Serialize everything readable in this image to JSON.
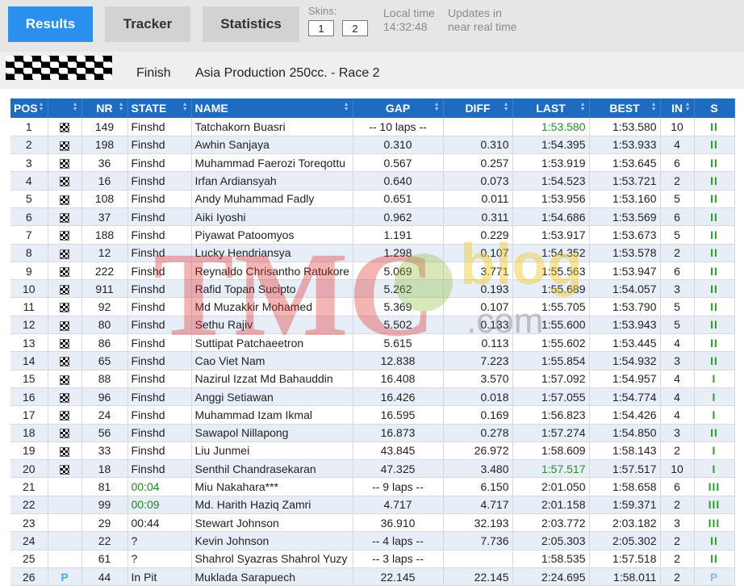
{
  "nav": {
    "results_label": "Results",
    "tracker_label": "Tracker",
    "statistics_label": "Statistics",
    "skins_label": "Skins:",
    "skin1_label": "1",
    "skin2_label": "2",
    "local_time_label": "Local time",
    "local_time_value": "14:32:48",
    "updates_line1": "Updates in",
    "updates_line2": "near real time"
  },
  "race": {
    "status": "Finish",
    "name": "Asia Production 250cc. - Race 2"
  },
  "watermark": {
    "text_left": "TMC",
    "text_right": "blog",
    "text_domain": ".com"
  },
  "columns": [
    "POS",
    "NR",
    "STATE",
    "NAME",
    "GAP",
    "DIFF",
    "LAST",
    "BEST",
    "IN",
    "S"
  ],
  "colors": {
    "header_bg": "#1d6cc1",
    "accent": "#2b8fee",
    "green": "#2aa02a",
    "pit": "#4aa8e6"
  },
  "rows": [
    {
      "pos": "1",
      "flag": "checkered",
      "nr": "149",
      "state": "Finshd",
      "name": "Tatchakorn Buasri",
      "gap": "-- 10 laps --",
      "diff": "",
      "last": "1:53.580",
      "last_best": true,
      "best": "1:53.580",
      "in": "10",
      "s": "II",
      "s_color": "g"
    },
    {
      "pos": "2",
      "flag": "checkered",
      "nr": "198",
      "state": "Finshd",
      "name": "Awhin Sanjaya",
      "gap": "0.310",
      "diff": "0.310",
      "last": "1:54.395",
      "last_best": false,
      "best": "1:53.933",
      "in": "4",
      "s": "II",
      "s_color": "g"
    },
    {
      "pos": "3",
      "flag": "checkered",
      "nr": "36",
      "state": "Finshd",
      "name": "Muhammad Faerozi Toreqottu",
      "gap": "0.567",
      "diff": "0.257",
      "last": "1:53.919",
      "last_best": false,
      "best": "1:53.645",
      "in": "6",
      "s": "II",
      "s_color": "g"
    },
    {
      "pos": "4",
      "flag": "checkered",
      "nr": "16",
      "state": "Finshd",
      "name": "Irfan Ardiansyah",
      "gap": "0.640",
      "diff": "0.073",
      "last": "1:54.523",
      "last_best": false,
      "best": "1:53.721",
      "in": "2",
      "s": "II",
      "s_color": "g"
    },
    {
      "pos": "5",
      "flag": "checkered",
      "nr": "108",
      "state": "Finshd",
      "name": "Andy Muhammad Fadly",
      "gap": "0.651",
      "diff": "0.011",
      "last": "1:53.956",
      "last_best": false,
      "best": "1:53.160",
      "in": "5",
      "s": "II",
      "s_color": "g"
    },
    {
      "pos": "6",
      "flag": "checkered",
      "nr": "37",
      "state": "Finshd",
      "name": "Aiki Iyoshi",
      "gap": "0.962",
      "diff": "0.311",
      "last": "1:54.686",
      "last_best": false,
      "best": "1:53.569",
      "in": "6",
      "s": "II",
      "s_color": "g"
    },
    {
      "pos": "7",
      "flag": "checkered",
      "nr": "188",
      "state": "Finshd",
      "name": "Piyawat Patoomyos",
      "gap": "1.191",
      "diff": "0.229",
      "last": "1:53.917",
      "last_best": false,
      "best": "1:53.673",
      "in": "5",
      "s": "II",
      "s_color": "g"
    },
    {
      "pos": "8",
      "flag": "checkered",
      "nr": "12",
      "state": "Finshd",
      "name": "Lucky Hendriansya",
      "gap": "1.298",
      "diff": "0.107",
      "last": "1:54.352",
      "last_best": false,
      "best": "1:53.578",
      "in": "2",
      "s": "II",
      "s_color": "g"
    },
    {
      "pos": "9",
      "flag": "checkered",
      "nr": "222",
      "state": "Finshd",
      "name": "Reynaldo Chrisantho Ratukore",
      "gap": "5.069",
      "diff": "3.771",
      "last": "1:55.563",
      "last_best": false,
      "best": "1:53.947",
      "in": "6",
      "s": "II",
      "s_color": "g"
    },
    {
      "pos": "10",
      "flag": "checkered",
      "nr": "911",
      "state": "Finshd",
      "name": "Rafid Topan Sucipto",
      "gap": "5.262",
      "diff": "0.193",
      "last": "1:55.689",
      "last_best": false,
      "best": "1:54.057",
      "in": "3",
      "s": "II",
      "s_color": "g"
    },
    {
      "pos": "11",
      "flag": "checkered",
      "nr": "92",
      "state": "Finshd",
      "name": "Md Muzakkir Mohamed",
      "gap": "5.369",
      "diff": "0.107",
      "last": "1:55.705",
      "last_best": false,
      "best": "1:53.790",
      "in": "5",
      "s": "II",
      "s_color": "g"
    },
    {
      "pos": "12",
      "flag": "checkered",
      "nr": "80",
      "state": "Finshd",
      "name": "Sethu Rajiv",
      "gap": "5.502",
      "diff": "0.133",
      "last": "1:55.600",
      "last_best": false,
      "best": "1:53.943",
      "in": "5",
      "s": "II",
      "s_color": "g"
    },
    {
      "pos": "13",
      "flag": "checkered",
      "nr": "86",
      "state": "Finshd",
      "name": "Suttipat Patchaeetron",
      "gap": "5.615",
      "diff": "0.113",
      "last": "1:55.602",
      "last_best": false,
      "best": "1:53.445",
      "in": "4",
      "s": "II",
      "s_color": "g"
    },
    {
      "pos": "14",
      "flag": "checkered",
      "nr": "65",
      "state": "Finshd",
      "name": "Cao Viet Nam",
      "gap": "12.838",
      "diff": "7.223",
      "last": "1:55.854",
      "last_best": false,
      "best": "1:54.932",
      "in": "3",
      "s": "II",
      "s_color": "g"
    },
    {
      "pos": "15",
      "flag": "checkered",
      "nr": "88",
      "state": "Finshd",
      "name": "Nazirul Izzat Md Bahauddin",
      "gap": "16.408",
      "diff": "3.570",
      "last": "1:57.092",
      "last_best": false,
      "best": "1:54.957",
      "in": "4",
      "s": "I",
      "s_color": "g"
    },
    {
      "pos": "16",
      "flag": "checkered",
      "nr": "96",
      "state": "Finshd",
      "name": "Anggi Setiawan",
      "gap": "16.426",
      "diff": "0.018",
      "last": "1:57.055",
      "last_best": false,
      "best": "1:54.774",
      "in": "4",
      "s": "I",
      "s_color": "g"
    },
    {
      "pos": "17",
      "flag": "checkered",
      "nr": "24",
      "state": "Finshd",
      "name": "Muhammad Izam Ikmal",
      "gap": "16.595",
      "diff": "0.169",
      "last": "1:56.823",
      "last_best": false,
      "best": "1:54.426",
      "in": "4",
      "s": "I",
      "s_color": "g"
    },
    {
      "pos": "18",
      "flag": "checkered",
      "nr": "56",
      "state": "Finshd",
      "name": "Sawapol Nillapong",
      "gap": "16.873",
      "diff": "0.278",
      "last": "1:57.274",
      "last_best": false,
      "best": "1:54.850",
      "in": "3",
      "s": "II",
      "s_color": "g"
    },
    {
      "pos": "19",
      "flag": "checkered",
      "nr": "33",
      "state": "Finshd",
      "name": "Liu Junmei",
      "gap": "43.845",
      "diff": "26.972",
      "last": "1:58.609",
      "last_best": false,
      "best": "1:58.143",
      "in": "2",
      "s": "I",
      "s_color": "g"
    },
    {
      "pos": "20",
      "flag": "checkered",
      "nr": "18",
      "state": "Finshd",
      "name": "Senthil Chandrasekaran",
      "gap": "47.325",
      "diff": "3.480",
      "last": "1:57.517",
      "last_best": true,
      "best": "1:57.517",
      "in": "10",
      "s": "I",
      "s_color": "g"
    },
    {
      "pos": "21",
      "flag": "",
      "nr": "81",
      "state": "00:04",
      "state_green": true,
      "name": "Miu Nakahara***",
      "gap": "-- 9 laps --",
      "diff": "6.150",
      "last": "2:01.050",
      "last_best": false,
      "best": "1:58.658",
      "in": "6",
      "s": "III",
      "s_color": "g"
    },
    {
      "pos": "22",
      "flag": "",
      "nr": "99",
      "state": "00:09",
      "state_green": true,
      "name": "Md. Harith Haziq Zamri",
      "gap": "4.717",
      "diff": "4.717",
      "last": "2:01.158",
      "last_best": false,
      "best": "1:59.371",
      "in": "2",
      "s": "III",
      "s_color": "g"
    },
    {
      "pos": "23",
      "flag": "",
      "nr": "29",
      "state": "00:44",
      "state_green": false,
      "name": "Stewart Johnson",
      "gap": "36.910",
      "diff": "32.193",
      "last": "2:03.772",
      "last_best": false,
      "best": "2:03.182",
      "in": "3",
      "s": "III",
      "s_color": "g"
    },
    {
      "pos": "24",
      "flag": "",
      "nr": "22",
      "state": "?",
      "state_green": false,
      "name": "Kevin Johnson",
      "gap": "-- 4 laps --",
      "diff": "7.736",
      "last": "2:05.303",
      "last_best": false,
      "best": "2:05.302",
      "in": "2",
      "s": "II",
      "s_color": "g"
    },
    {
      "pos": "25",
      "flag": "",
      "nr": "61",
      "state": "?",
      "state_green": false,
      "name": "Shahrol Syazras Shahrol Yuzy",
      "gap": "-- 3 laps --",
      "diff": "",
      "last": "1:58.535",
      "last_best": false,
      "best": "1:57.518",
      "in": "2",
      "s": "II",
      "s_color": "g"
    },
    {
      "pos": "26",
      "flag": "pit",
      "nr": "44",
      "state": "In Pit",
      "state_green": false,
      "name": "Muklada Sarapuech",
      "gap": "22.145",
      "diff": "22.145",
      "last": "2:24.695",
      "last_best": false,
      "best": "1:58.011",
      "in": "2",
      "s": "P",
      "s_color": "b"
    }
  ]
}
